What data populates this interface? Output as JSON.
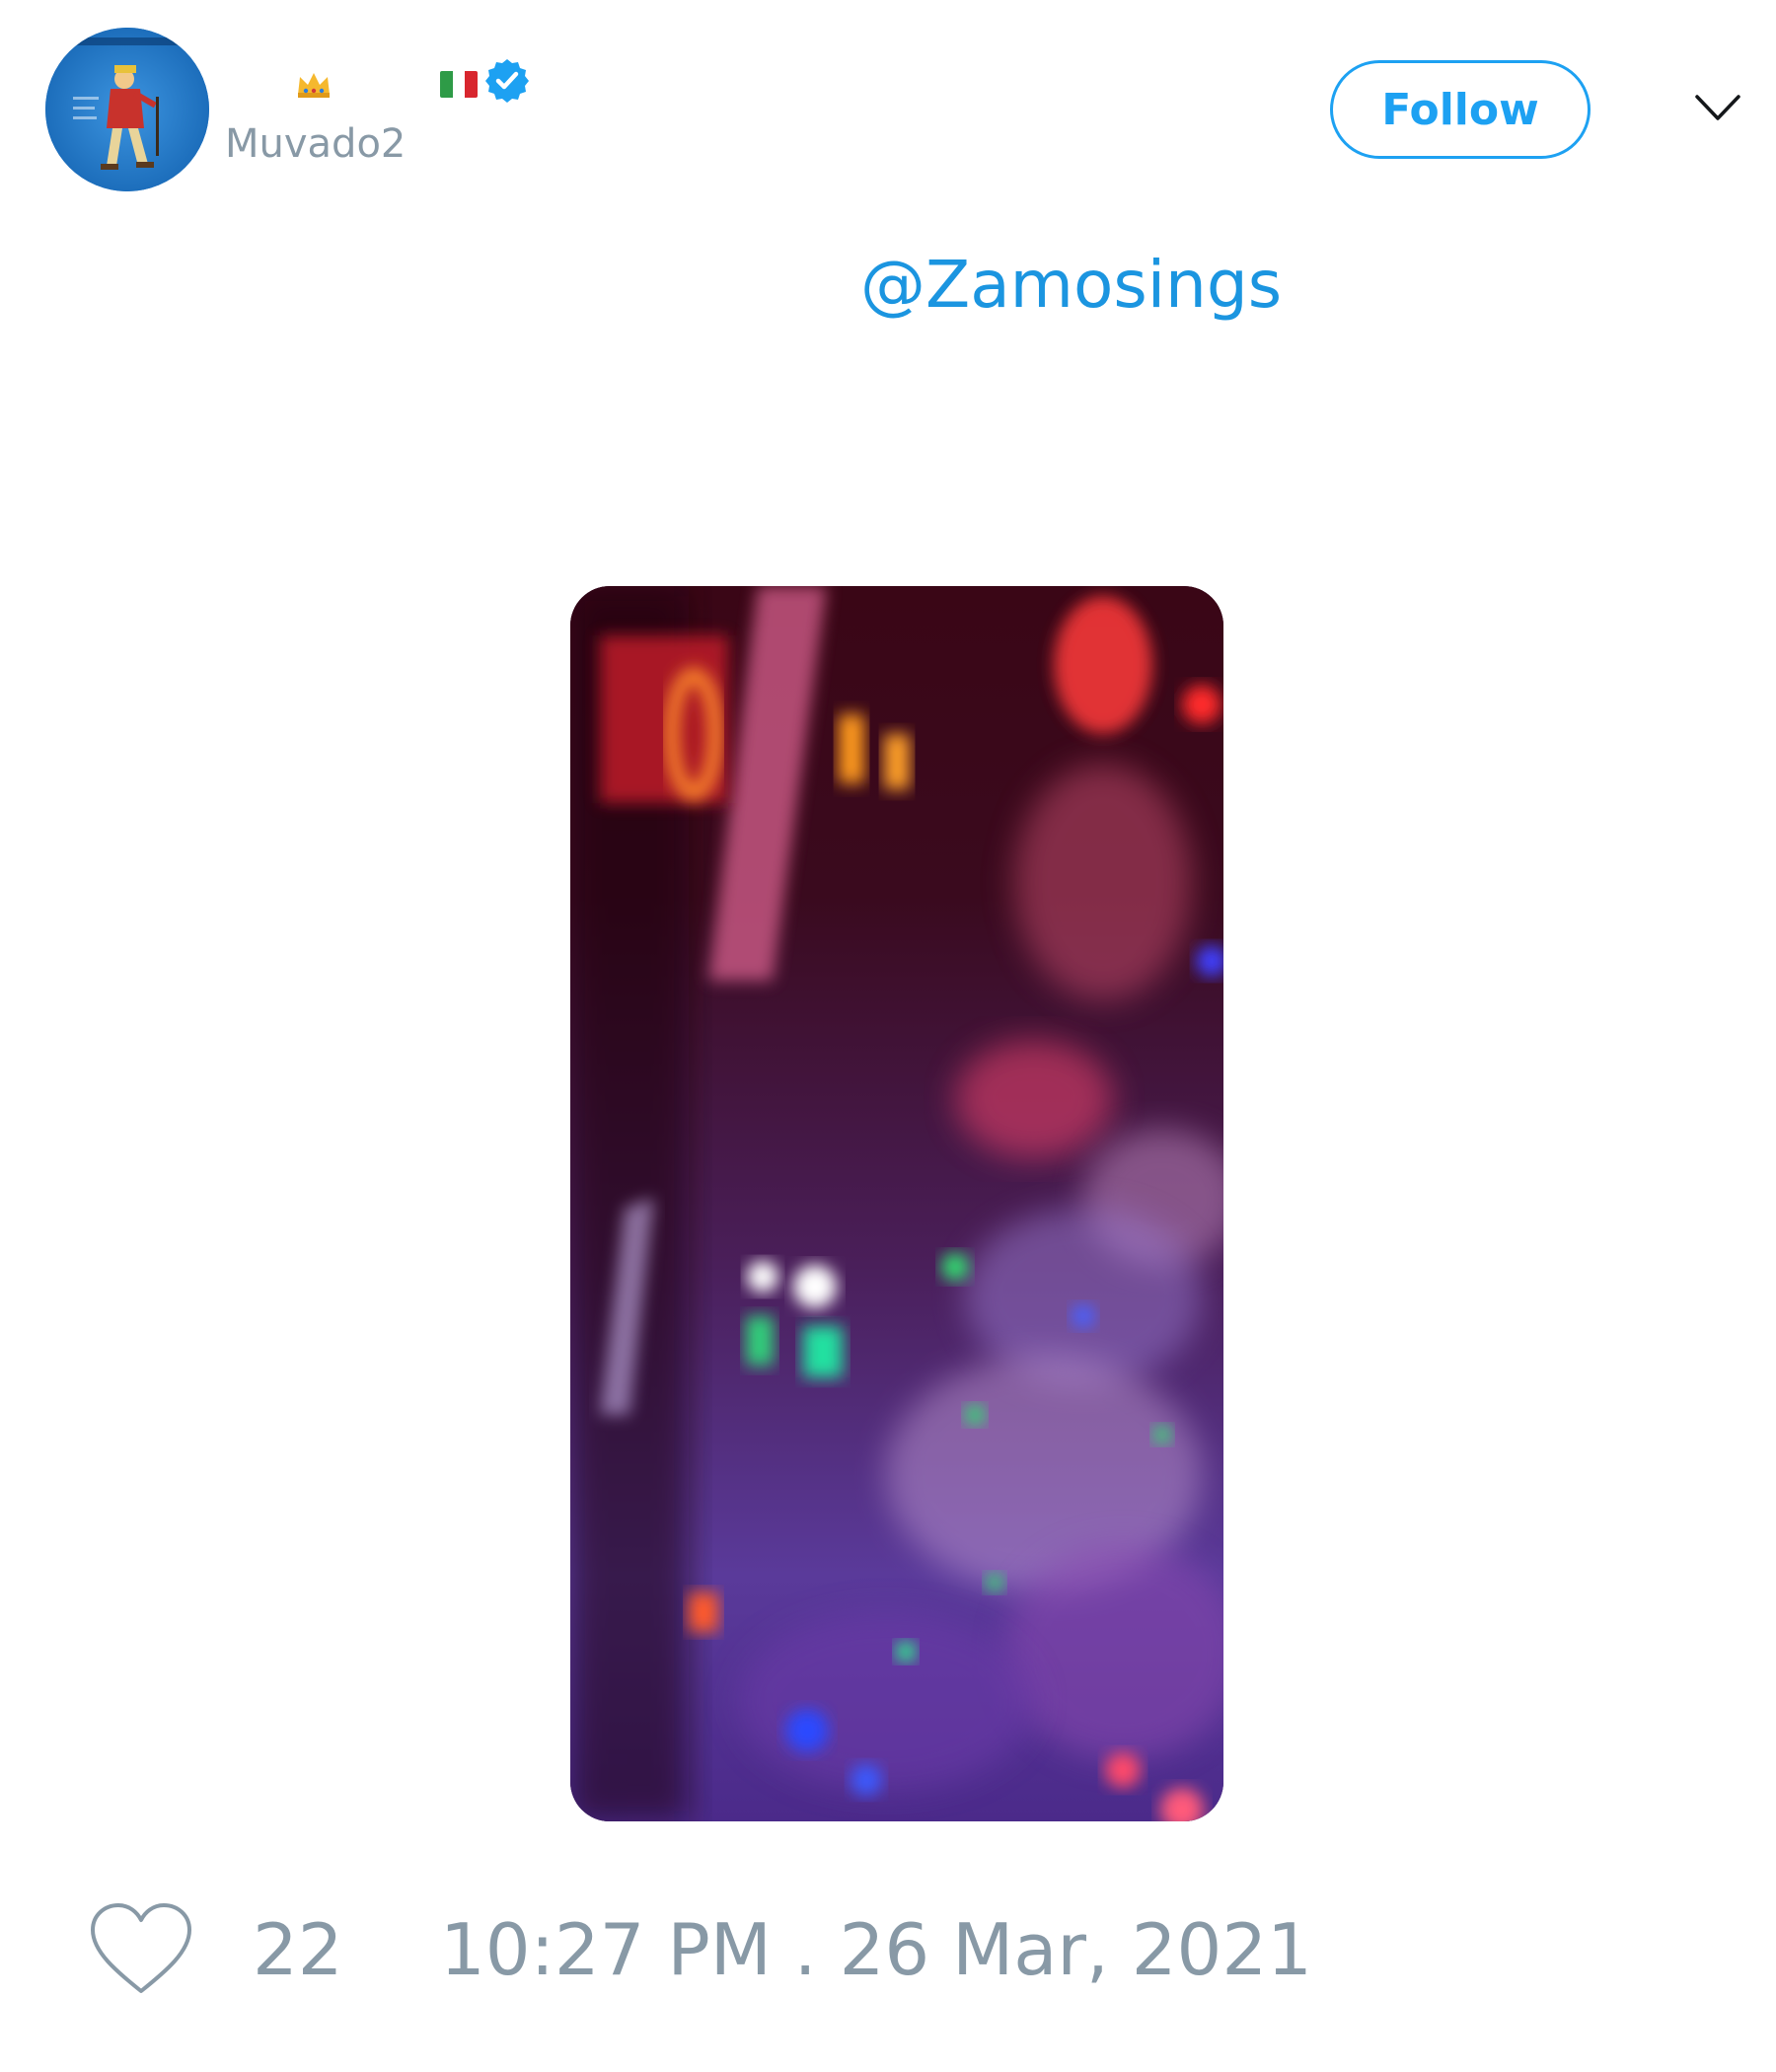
{
  "tweet": {
    "author": {
      "handle": "Muvado2",
      "avatar_icon": "avatar-illustration",
      "name_icons": [
        "crown-emoji",
        "italy-flag-emoji",
        "verified-badge"
      ],
      "verified": true
    },
    "follow_label": "Follow",
    "menu_icon": "chevron-down-icon",
    "text": {
      "mention": "@Zamosings"
    },
    "media": {
      "type": "video",
      "description_icon": "video-thumbnail"
    },
    "footer": {
      "like_icon": "heart-outline-icon",
      "like_count": "22",
      "timestamp": "10:27 PM . 26 Mar, 2021"
    }
  },
  "colors": {
    "accent": "#1da1f2",
    "link": "#1b95e0",
    "muted": "#8899a6",
    "verified": "#1da1f2"
  }
}
